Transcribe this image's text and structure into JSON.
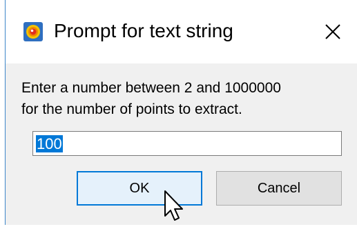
{
  "dialog": {
    "title": "Prompt for text string",
    "icon": "app-logo-icon",
    "close_icon": "close-icon",
    "message_line1": "Enter a number between 2 and 1000000",
    "message_line2": "for the number of points to extract.",
    "input_value": "100",
    "ok_label": "OK",
    "cancel_label": "Cancel"
  },
  "colors": {
    "accent": "#0078d7",
    "body_bg": "#f0f0f0",
    "ok_bg": "#e5f1fb",
    "cancel_bg": "#e1e1e1"
  },
  "cursor": "mouse-pointer-icon"
}
